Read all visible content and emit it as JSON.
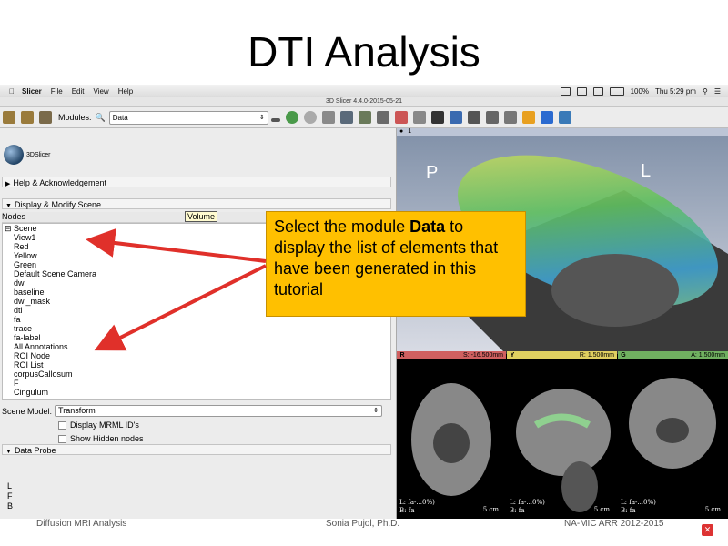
{
  "slide": {
    "title": "DTI Analysis"
  },
  "mac_menubar": {
    "app_name": "Slicer",
    "menus": [
      "File",
      "Edit",
      "View",
      "Help"
    ],
    "battery": "100%",
    "clock": "Thu 5:29 pm"
  },
  "window": {
    "title": "3D Slicer 4.4.0-2015-05-21"
  },
  "toolbar": {
    "modules_label": "Modules:",
    "selected_module": "Data"
  },
  "panel": {
    "logo_text": "3DSlicer",
    "help_section": "Help & Acknowledgement",
    "display_section": "Display & Modify Scene",
    "nodes_header": "Nodes",
    "scene_root": "Scene",
    "nodes": [
      "View1",
      "Red",
      "Yellow",
      "Green",
      "Default Scene Camera",
      "dwi",
      "baseline",
      "dwi_mask",
      "dti",
      "fa",
      "trace",
      "fa-label",
      "All Annotations",
      "ROI Node",
      "ROI List",
      "corpusCallosum",
      "F",
      "Cingulum"
    ],
    "tooltip": "Volume",
    "scene_model_label": "Scene Model:",
    "scene_model_value": "Transform",
    "display_mrml_ids": "Display MRML ID's",
    "show_hidden": "Show Hidden nodes",
    "data_probe": "Data Probe",
    "probe_letters": [
      "L",
      "F",
      "B"
    ]
  },
  "viewer": {
    "view3d_label": "1",
    "label_p": "P",
    "label_l": "L",
    "red": {
      "letter": "R",
      "offset": "S: -16.500mm",
      "info1": "L: fa-...0%)",
      "info2": "B: fa"
    },
    "yellow": {
      "letter": "Y",
      "offset": "R: 1.500mm",
      "info1": "L: fa-...0%)",
      "info2": "B: fa"
    },
    "green": {
      "letter": "G",
      "offset": "A: 1.500mm",
      "info1": "L: fa-...0%)",
      "info2": "B: fa"
    },
    "scale": "5 cm"
  },
  "callout": {
    "text_before": "Select the module ",
    "text_bold": "Data",
    "text_after": " to display the list of elements that have been generated in this tutorial"
  },
  "footer": {
    "left": "Diffusion MRI Analysis",
    "center": "Sonia Pujol, Ph.D.",
    "right": "NA-MIC ARR 2012-2015"
  },
  "colors": {
    "callout_bg": "#ffc000",
    "arrow": "#e0302a",
    "red_slice": "#d06060",
    "yellow_slice": "#e0d060",
    "green_slice": "#70b060"
  }
}
